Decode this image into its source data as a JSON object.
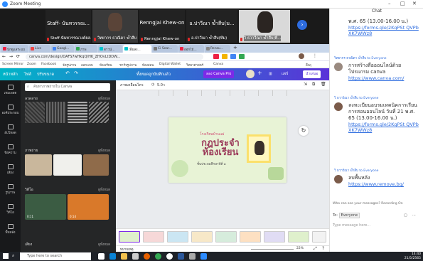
{
  "zoom": {
    "title": "Zoom Meeting"
  },
  "videos": [
    {
      "top_name": "Staff- นันทวรรณ...",
      "bottom_name": "Staff-นันทวรรณวงค์ผล..."
    },
    {
      "bottom_name": "วิทยากร ธวณิดา ฆ้ำสืบ"
    },
    {
      "top_name": "Renngjai Khew-on",
      "bottom_name": "Renngjai Khew-on"
    },
    {
      "top_name": "อ.ปาวีณา ฆ้ำสืบ(ม...",
      "bottom_name": "อ.ปาวีณา ฆ้ำสืบ(ทีม)"
    },
    {
      "bottom_name": "วิ ธวาวีณา ฆ้ำสืบ(ที..."
    }
  ],
  "browser": {
    "tabs": [
      "นักดูแลระบบ",
      "Live",
      "Googl...",
      "ภาพ",
      "ดาวน์...",
      "เพิ่มลง...",
      "Ci Sear...",
      "ออกไม้...",
      "Renzu..."
    ],
    "url": "canva.com/design/DAFS7wHkqQ/HK_ZHOvLtDDW...",
    "bookmarks": [
      "Screen Mirror",
      "Zoom",
      "Facebook",
      "จัดรูปภาพ",
      "ออกแบบ",
      "ห้องเรียน",
      "ชาร์จรูปภาพ",
      "ห้องสอน",
      "Digital Wallet",
      "วิทยาศาสตร์",
      "Canva",
      "อื่นๆ"
    ]
  },
  "canva": {
    "header": {
      "home": "หน้าหลัก",
      "file": "ไฟล์",
      "resize": "ปรับขนาด",
      "saved": "ทั้งหมดถูกบันทึกแล้ว",
      "try_pro": "ลอง Canva Pro",
      "share": "แชร์",
      "present": "นำเสนอ"
    },
    "sidebar": [
      "เทมเพลต",
      "องค์ประกอบ",
      "อัปโหลด",
      "ข้อความ",
      "เสียง",
      "รูปภาพ",
      "วิดีโอ",
      "พื้นหลัง"
    ],
    "panel": {
      "search_placeholder": "ค้นหาภาพถ่ายใน Canva",
      "section1": "ลวดลาย",
      "see_all1": "ดูทั้งหมด",
      "section2": "ภาพถ่าย",
      "see_all2": "ดูทั้งหมด",
      "section3": "วิดีโอ",
      "see_all3": "ดูทั้งหมด",
      "video_len1": "0:11",
      "video_len2": "0:14",
      "section4": "เสียง",
      "see_all4": "ดูทั้งหมด"
    },
    "toolbar": {
      "animate": "ภาพเคลื่อนไหว",
      "duration": "5.0ว"
    },
    "slide": {
      "subtitle": "โรงเรียนบ้านแม่",
      "title1": "กฎประจำ",
      "title2": "ห้องเรียน",
      "footer": "ชั้นประถมศึกษาปีที่ ๑"
    },
    "footer": {
      "notes": "หมายเหตุ",
      "zoom": "22%"
    }
  },
  "chat": {
    "header": "Chat",
    "messages": [
      {
        "body": "พ.ศ. 65 (13.00-16.00 น.)",
        "link": "https://forms.gle/2KgPSt QVPbXK7WWz8"
      },
      {
        "sender": "วิทยากร ธวณิดา ฆ้ำสืบ to Everyone",
        "body": "การสร้างสื่อออนไลน์ด้วยโปรแกรม canva",
        "link": "https://www.canva.com/"
      },
      {
        "sender": "วิ ธวาวีณา ฆ้ำสืบ to Everyone",
        "body": "ลงทะเบียนอบรมเทคนิคการเรียนการสอนออนไลน์ วันที่ 21 พ.ศ. 65 (13.00-16.00 น.)",
        "link": "https://forms.gle/2KgPSt QVPbXK7WWz8"
      },
      {
        "sender": "วิ ธวาวีณา ฆ้ำสืบ to Everyone",
        "body": "ลบพื้นหลัง",
        "link": "https://www.remove.bg/"
      }
    ],
    "who_can_see": "Who can see your messages? Recording On",
    "to_label": "To:",
    "to_value": "Everyone",
    "input_placeholder": "Type message here..."
  },
  "taskbar": {
    "search": "Type here to search",
    "time": "14:40",
    "date": "21/5/2565"
  }
}
